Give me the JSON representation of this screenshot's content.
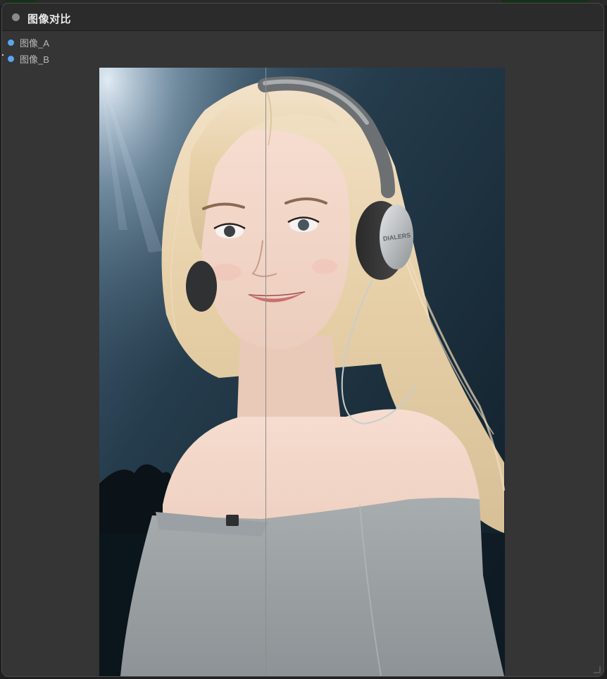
{
  "node": {
    "title": "图像对比",
    "inputs": [
      {
        "label": "图像_A",
        "color": "#58a6ee"
      },
      {
        "label": "图像_B",
        "color": "#58a6ee"
      }
    ]
  },
  "compare": {
    "split_fraction": 0.41,
    "image_text": "DIALERS"
  },
  "colors": {
    "node_bg": "#353535",
    "titlebar_bg": "#2b2b2b",
    "slot_dot": "#58a6ee"
  }
}
